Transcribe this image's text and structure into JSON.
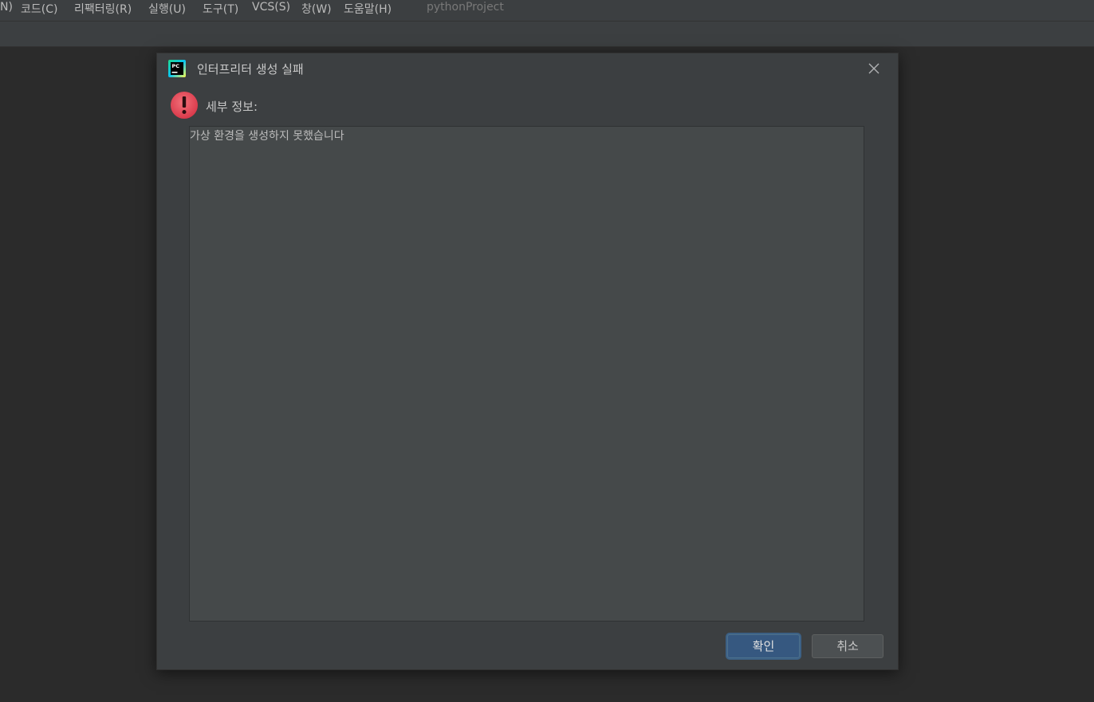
{
  "menubar": {
    "items": [
      {
        "label": "N)"
      },
      {
        "label": "코드(C)"
      },
      {
        "label": "리팩터링(R)"
      },
      {
        "label": "실행(U)"
      },
      {
        "label": "도구(T)"
      },
      {
        "label": "VCS(S)"
      },
      {
        "label": "창(W)"
      },
      {
        "label": "도움말(H)"
      }
    ],
    "project_name": "pythonProject"
  },
  "dialog": {
    "app_icon": "pycharm-icon",
    "title": "인터프리터 생성 실패",
    "close_icon": "close-icon",
    "error_icon": "error-icon",
    "details_label": "세부 정보:",
    "details_text": "가상 환경을 생성하지 못했습니다",
    "ok_label": "확인",
    "cancel_label": "취소"
  },
  "colors": {
    "ide_background": "#2b2b2b",
    "dialog_background": "#3c3f41",
    "details_background": "#45494a",
    "primary_button": "#365880",
    "error": "#e0444f"
  }
}
